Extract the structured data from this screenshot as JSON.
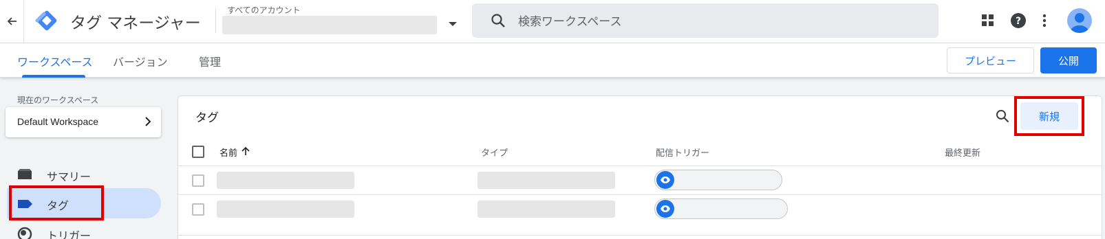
{
  "header": {
    "app_title": "タグ マネージャー",
    "account_label": "すべてのアカウント",
    "search_placeholder": "検索ワークスペース"
  },
  "tabs": [
    {
      "label": "ワークスペース",
      "active": true
    },
    {
      "label": "バージョン",
      "active": false
    },
    {
      "label": "管理",
      "active": false
    }
  ],
  "actions": {
    "preview_label": "プレビュー",
    "publish_label": "公開"
  },
  "sidebar": {
    "workspace_label": "現在のワークスペース",
    "workspace_name": "Default Workspace",
    "items": [
      {
        "label": "サマリー",
        "icon": "folder-icon",
        "active": false
      },
      {
        "label": "タグ",
        "icon": "tag-icon",
        "active": true
      },
      {
        "label": "トリガー",
        "icon": "trigger-icon",
        "active": false
      }
    ]
  },
  "tags_panel": {
    "title": "タグ",
    "new_button": "新規",
    "columns": {
      "name": "名前",
      "type": "タイプ",
      "trigger": "配信トリガー",
      "updated": "最終更新"
    },
    "sort_indicator": "ascending"
  },
  "colors": {
    "accent": "#1a73e8",
    "highlight_box": "#e50000",
    "active_nav_bg": "#cfe0fc"
  }
}
